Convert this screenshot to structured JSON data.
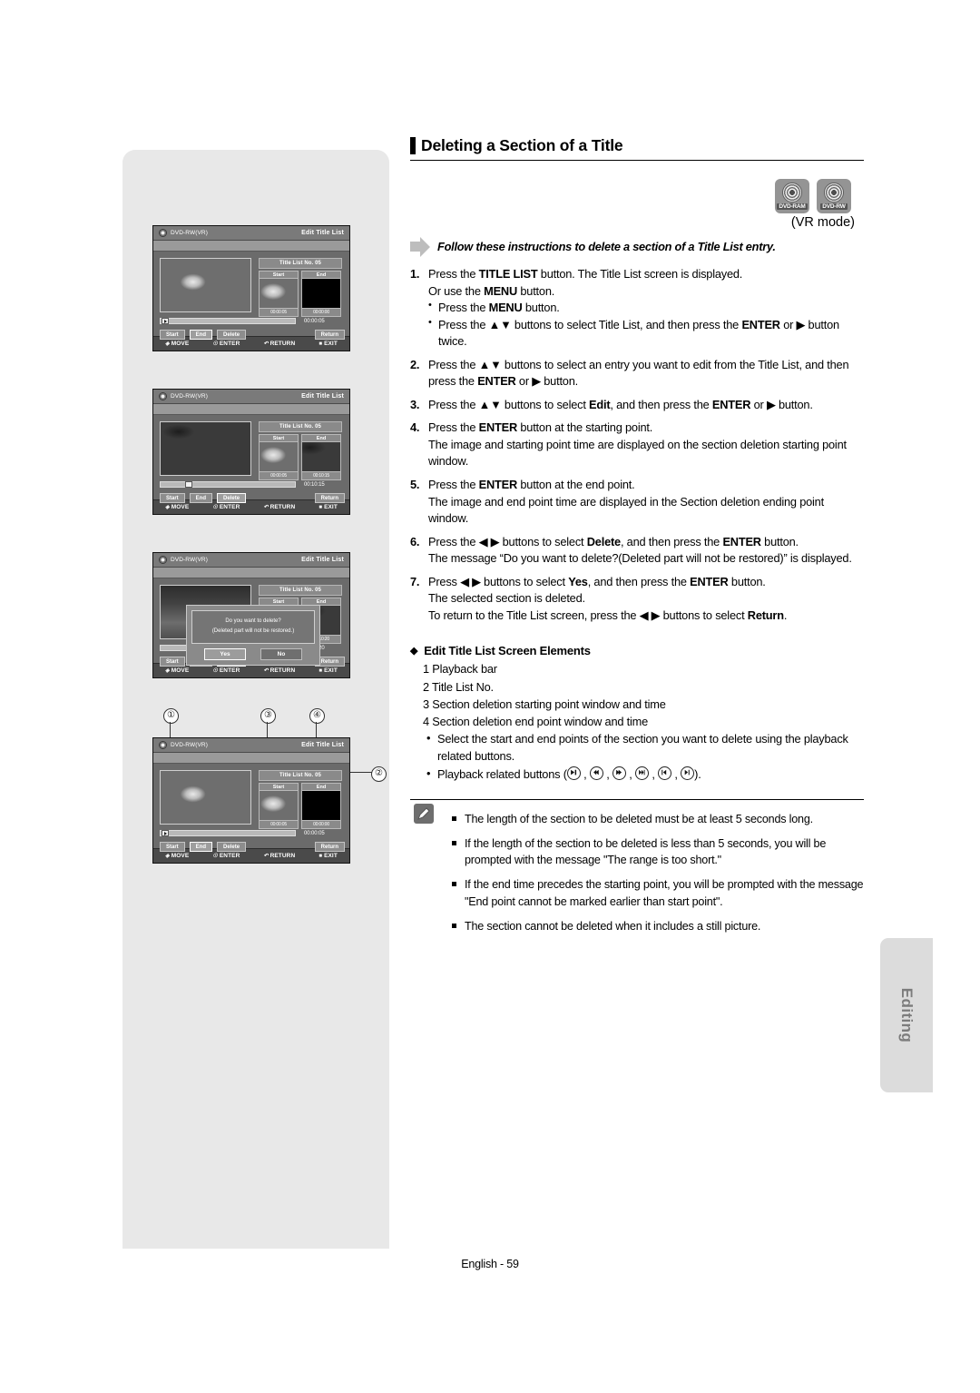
{
  "page": {
    "title": "Deleting a Section of a Title",
    "footer": "English - 59",
    "side_tab": "Editing",
    "vr_mode": "(VR mode)",
    "intro": "Follow these instructions to delete a section of a Title List entry."
  },
  "badges": [
    {
      "label": "DVD-RAM",
      "name": "dvd-ram-badge"
    },
    {
      "label": "DVD-RW",
      "name": "dvd-rw-badge"
    }
  ],
  "steps": [
    {
      "no": "1.",
      "lines": [
        {
          "type": "main",
          "html": "Press the <b>TITLE LIST</b> button. The Title List screen is displayed."
        },
        {
          "type": "main",
          "html": "Or use the <b>MENU</b> button."
        },
        {
          "type": "sub",
          "html": "Press the <b>MENU</b> button."
        },
        {
          "type": "sub",
          "html": "Press the ▲▼ buttons to select Title List, and then press the <b>ENTER</b> or ▶ button twice."
        }
      ]
    },
    {
      "no": "2.",
      "lines": [
        {
          "type": "main",
          "html": "Press the ▲▼ buttons to select an entry you want to edit from the Title List, and then press the <b>ENTER</b> or ▶ button."
        }
      ]
    },
    {
      "no": "3.",
      "lines": [
        {
          "type": "main",
          "html": "Press the ▲▼ buttons to select <b>Edit</b>, and then press the <b>ENTER</b> or ▶ button."
        }
      ]
    },
    {
      "no": "4.",
      "lines": [
        {
          "type": "main",
          "html": "Press the <b>ENTER</b> button at the starting point."
        },
        {
          "type": "main",
          "html": "The image and starting point time are displayed on the section deletion starting point window."
        }
      ]
    },
    {
      "no": "5.",
      "lines": [
        {
          "type": "main",
          "html": "Press the <b>ENTER</b> button at the end point."
        },
        {
          "type": "main",
          "html": "The image and end point time are displayed in the Section deletion ending point window."
        }
      ]
    },
    {
      "no": "6.",
      "lines": [
        {
          "type": "main",
          "html": "Press the ◀ ▶ buttons to select <b>Delete</b>, and then press the <b>ENTER</b> button."
        },
        {
          "type": "main",
          "html": "The message “Do you want to delete?(Deleted part will not be restored)” is displayed."
        }
      ]
    },
    {
      "no": "7.",
      "lines": [
        {
          "type": "main",
          "html": "Press ◀ ▶ buttons to select <b>Yes</b>, and then press the <b>ENTER</b> button."
        },
        {
          "type": "main",
          "html": "The selected section is deleted."
        },
        {
          "type": "main",
          "html": "To return to the Title List screen, press the ◀ ▶ buttons to select <b>Return</b>."
        }
      ]
    }
  ],
  "elements_section": {
    "heading": "Edit Title List Screen Elements",
    "items": [
      "1 Playback bar",
      "2 Title List No.",
      "3 Section deletion starting point window and time",
      "4 Section deletion end point window and time"
    ],
    "subitems": [
      "Select the start and end points of the section you want to delete using the playback related buttons.",
      "Playback related buttons ("
    ],
    "playback_buttons_suffix": ")."
  },
  "notes": [
    "The length of the section to be deleted must be at least 5 seconds long.",
    "If the length of the section to be deleted is less than 5 seconds, you will be prompted with the message \"The range is too short.\"",
    "If the end time precedes the starting point, you will be prompted with the message \"End point cannot be marked earlier than start point\".",
    "The section cannot be deleted when it includes a still picture."
  ],
  "screens": [
    {
      "id": "screen-1",
      "disc_label": "DVD-RW(VR)",
      "screen_title": "Edit Title List",
      "title_list_no": "Title List No.  05",
      "start_label": "Start",
      "end_label": "End",
      "start_time": "00:00:05",
      "end_time": "00:00:00",
      "bar_time": "00:00:05",
      "selected_button": "End",
      "buttons": [
        "Start",
        "End",
        "Delete"
      ],
      "return_label": "Return",
      "footer": [
        "MOVE",
        "ENTER",
        "RETURN",
        "EXIT"
      ]
    },
    {
      "id": "screen-2",
      "disc_label": "DVD-RW(VR)",
      "screen_title": "Edit Title List",
      "title_list_no": "Title List No. 05",
      "start_label": "Start",
      "end_label": "End",
      "start_time": "00:00:05",
      "end_time": "00:10:15",
      "bar_time": "00:10:15",
      "selected_button": "Delete",
      "buttons": [
        "Start",
        "End",
        "Delete"
      ],
      "return_label": "Return",
      "footer": [
        "MOVE",
        "ENTER",
        "RETURN",
        "EXIT"
      ]
    },
    {
      "id": "screen-3",
      "disc_label": "DVD-RW(VR)",
      "screen_title": "Edit Title List",
      "title_list_no": "Title List No. 05",
      "start_label": "Start",
      "end_label": "End",
      "start_time": "00:00:05",
      "end_time": "00:10:20",
      "bar_time": "00:10:20",
      "selected_button": "Delete",
      "buttons": [
        "Start",
        "End",
        "Delete"
      ],
      "return_label": "Return",
      "footer": [
        "MOVE",
        "ENTER",
        "RETURN",
        "EXIT"
      ],
      "dialog": {
        "line1": "Do you want to delete?",
        "line2": "(Deleted part will not be restored.)",
        "yes": "Yes",
        "no": "No",
        "selected": "Yes"
      }
    },
    {
      "id": "screen-4",
      "disc_label": "DVD-RW(VR)",
      "screen_title": "Edit Title List",
      "title_list_no": "Title List No.  05",
      "start_label": "Start",
      "end_label": "End",
      "start_time": "00:00:05",
      "end_time": "00:00:00",
      "bar_time": "00:00:05",
      "selected_button": "End",
      "buttons": [
        "Start",
        "End",
        "Delete"
      ],
      "return_label": "Return",
      "footer": [
        "MOVE",
        "ENTER",
        "RETURN",
        "EXIT"
      ]
    }
  ],
  "callouts": {
    "one": "①",
    "two": "②",
    "three": "③",
    "four": "④"
  }
}
